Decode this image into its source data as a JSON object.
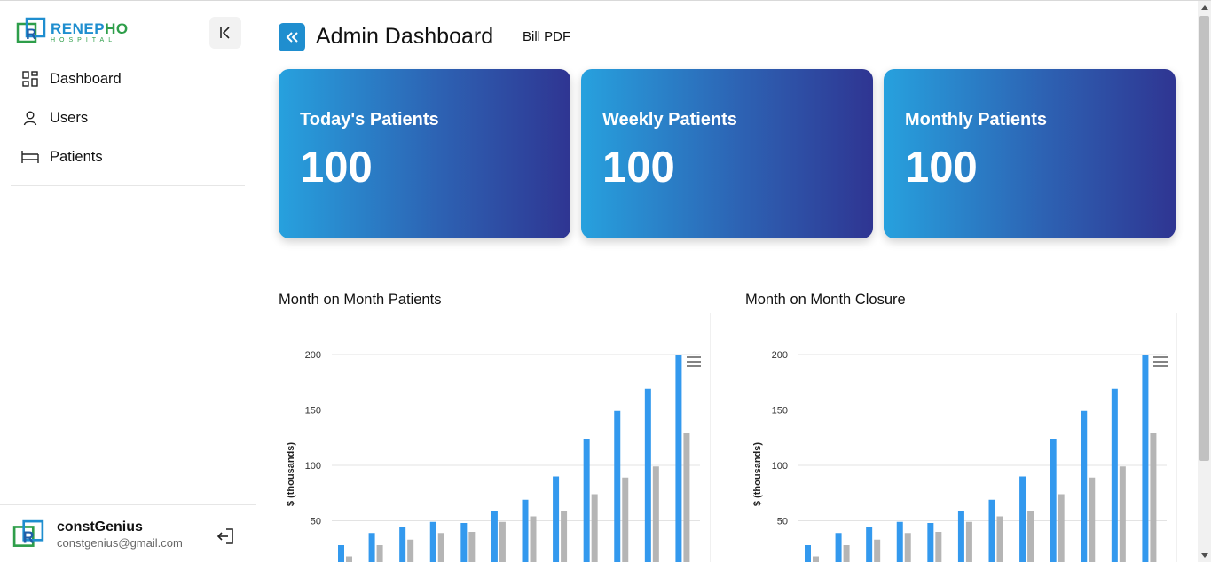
{
  "sidebar": {
    "logo": {
      "name_part1": "RENEP",
      "name_part2": "HO",
      "subtitle": "HOSPITAL"
    },
    "items": [
      {
        "label": "Dashboard",
        "icon": "dashboard-grid-icon"
      },
      {
        "label": "Users",
        "icon": "user-icon"
      },
      {
        "label": "Patients",
        "icon": "bed-icon"
      }
    ],
    "user": {
      "name": "constGenius",
      "email": "constgenius@gmail.com"
    }
  },
  "header": {
    "title": "Admin Dashboard",
    "bill_link": "Bill PDF"
  },
  "cards": [
    {
      "label": "Today's Patients",
      "value": "100"
    },
    {
      "label": "Weekly Patients",
      "value": "100"
    },
    {
      "label": "Monthly Patients",
      "value": "100"
    }
  ],
  "colors": {
    "accent": "#1f8ecf",
    "gradient_start": "#27a1de",
    "gradient_end": "#2f3592",
    "bar_primary": "#3399ee",
    "bar_secondary": "#b5b5b5"
  },
  "chart_data": [
    {
      "type": "bar",
      "title": "Month on Month Patients",
      "ylabel": "$ (thousands)",
      "yticks": [
        50,
        100,
        150,
        200
      ],
      "ylim": [
        0,
        200
      ],
      "grid": true,
      "series": [
        {
          "values": [
            28,
            39,
            44,
            49,
            48,
            59,
            69,
            90,
            124,
            149,
            169,
            200
          ]
        },
        {
          "values": [
            18,
            28,
            33,
            39,
            40,
            49,
            54,
            59,
            74,
            89,
            99,
            129
          ]
        }
      ]
    },
    {
      "type": "bar",
      "title": "Month on Month Closure",
      "ylabel": "$ (thousands)",
      "yticks": [
        50,
        100,
        150,
        200
      ],
      "ylim": [
        0,
        200
      ],
      "grid": true,
      "series": [
        {
          "values": [
            28,
            39,
            44,
            49,
            48,
            59,
            69,
            90,
            124,
            149,
            169,
            200
          ]
        },
        {
          "values": [
            18,
            28,
            33,
            39,
            40,
            49,
            54,
            59,
            74,
            89,
            99,
            129
          ]
        }
      ]
    }
  ]
}
